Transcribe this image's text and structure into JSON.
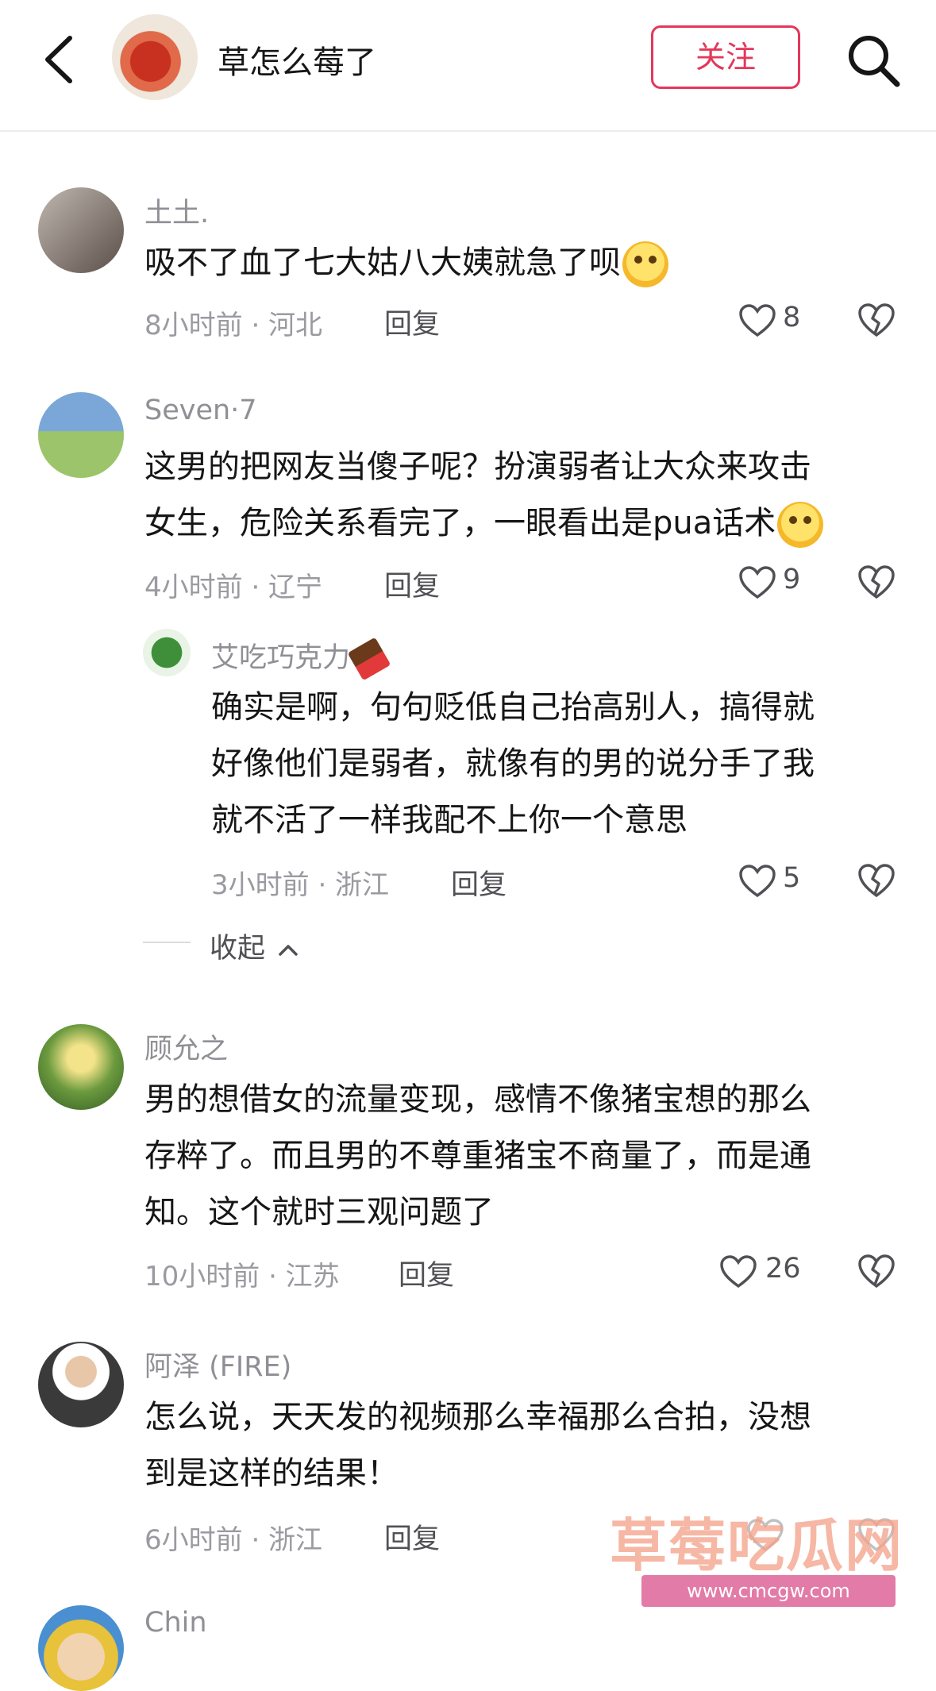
{
  "header": {
    "account_name": "草怎么莓了",
    "follow_label": "关注"
  },
  "comments": [
    {
      "name": "土土.",
      "text": "吸不了血了七大姑八大姨就急了呗",
      "meta": "8小时前 · 河北",
      "reply": "回复",
      "likes": "8"
    },
    {
      "name": "Seven·7",
      "text_line1": "这男的把网友当傻子呢？扮演弱者让大众来攻击",
      "text_line2": "女生，危险关系看完了，一眼看出是pua话术",
      "meta": "4小时前 · 辽宁",
      "reply": "回复",
      "likes": "9"
    },
    {
      "name": "顾允之",
      "text_line1": "男的想借女的流量变现，感情不像猪宝想的那么",
      "text_line2": "存粹了。而且男的不尊重猪宝不商量了，而是通",
      "text_line3": "知。这个就时三观问题了",
      "meta": "10小时前 · 江苏",
      "reply": "回复",
      "likes": "26"
    },
    {
      "name": "阿泽 (FIRE)",
      "text_line1": "怎么说，天天发的视频那么幸福那么合拍，没想",
      "text_line2": "到是这样的结果！",
      "meta": "6小时前 · 浙江",
      "reply": "回复"
    },
    {
      "name": "Chin"
    }
  ],
  "reply_comment": {
    "name": "艾吃巧克力",
    "text_line1": "确实是啊，句句贬低自己抬高别人，搞得就",
    "text_line2": "好像他们是弱者，就像有的男的说分手了我",
    "text_line3": "就不活了一样我配不上你一个意思",
    "meta": "3小时前 · 浙江",
    "reply": "回复",
    "likes": "5"
  },
  "collapse_label": "收起",
  "watermark": {
    "title": "草莓吃瓜网",
    "url": "www.cmcgw.com"
  },
  "colors": {
    "accent": "#e4375a"
  }
}
